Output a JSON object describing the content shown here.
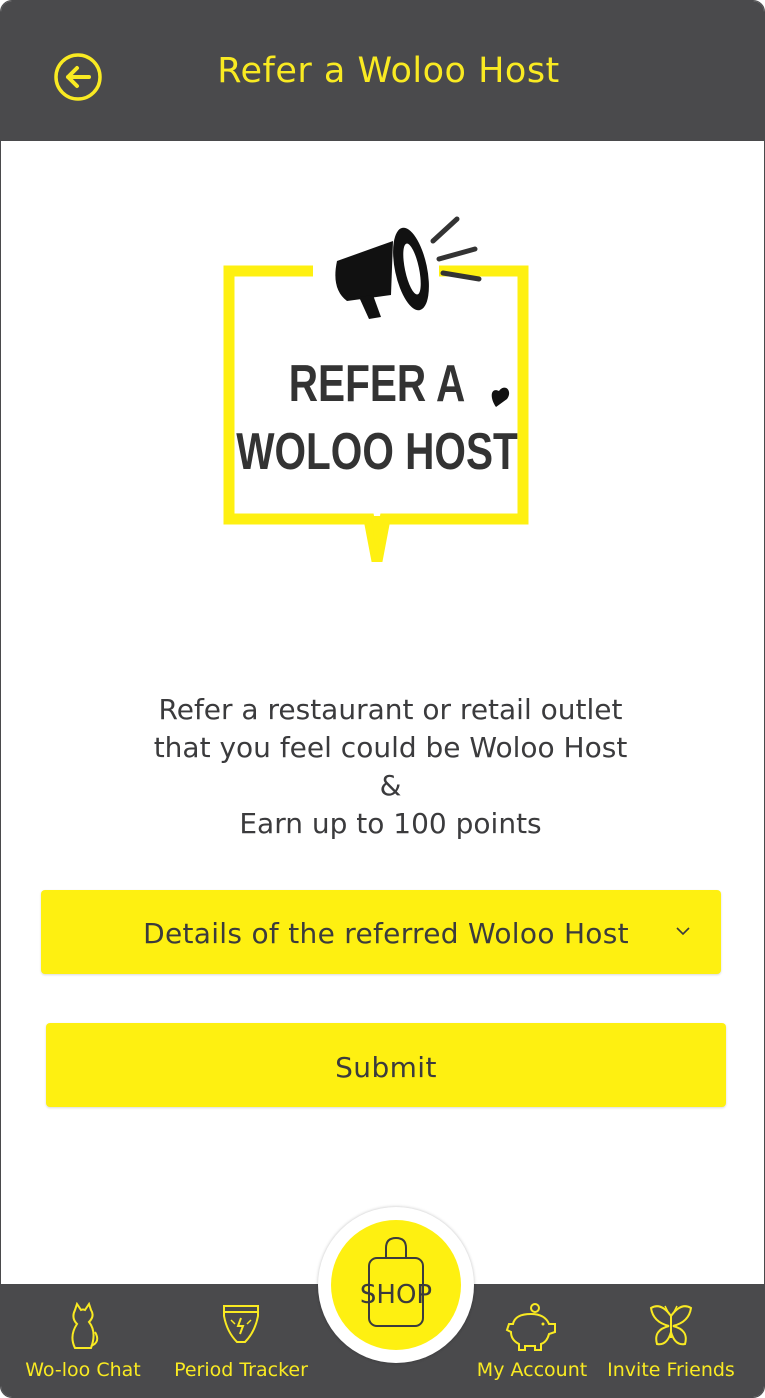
{
  "header": {
    "title": "Refer a Woloo Host"
  },
  "hero": {
    "line1": "REFER A",
    "line2": "WOLOO HOST"
  },
  "message": {
    "lines": [
      "Refer a restaurant or retail outlet",
      "that you feel could be Woloo Host",
      "&",
      "Earn up to 100 points"
    ]
  },
  "dropdown": {
    "label": "Details of the referred Woloo Host"
  },
  "submit": {
    "label": "Submit"
  },
  "tabbar": {
    "tabs": [
      {
        "label": "Wo-loo Chat",
        "icon": "cat-icon"
      },
      {
        "label": "Period Tracker",
        "icon": "period-tracker-icon"
      },
      {
        "label": "My Account",
        "icon": "piggy-bank-icon"
      },
      {
        "label": "Invite Friends",
        "icon": "butterfly-icon"
      }
    ],
    "shop": {
      "label": "SHOP",
      "icon": "shopping-bag-icon"
    }
  },
  "colors": {
    "header_bg": "#4a4a4c",
    "accent": "#fef011",
    "text_accent": "#f9ea22",
    "text": "#3b3b3d"
  }
}
